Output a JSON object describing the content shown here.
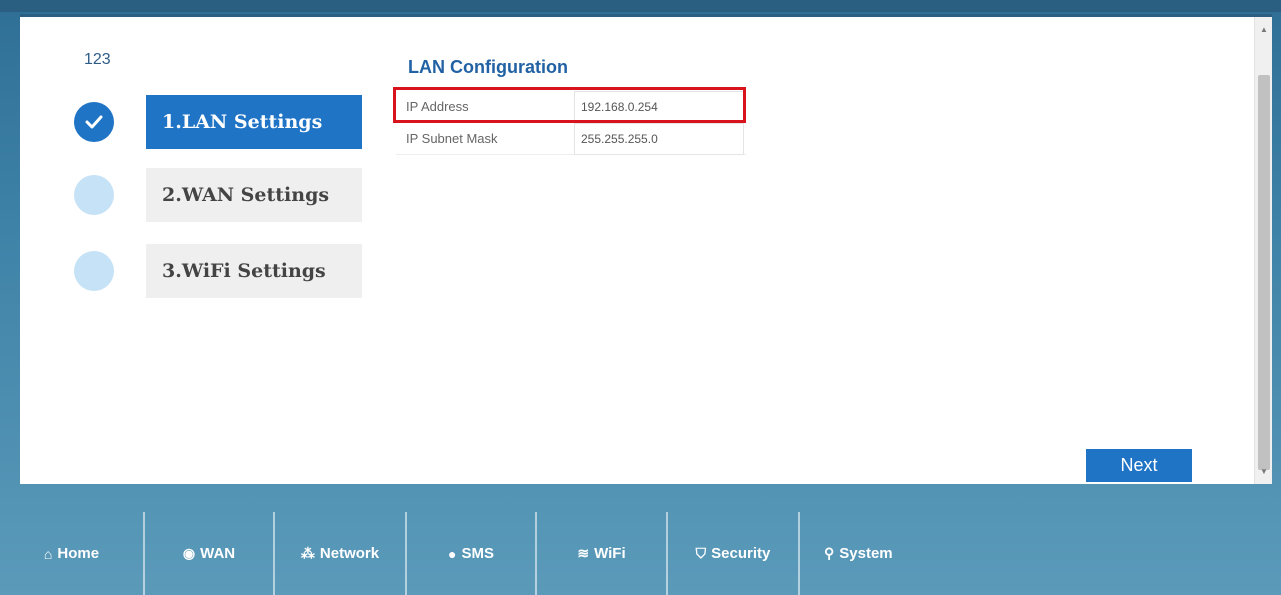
{
  "wizard": {
    "number": "123",
    "steps": [
      {
        "label": "1.LAN Settings"
      },
      {
        "label": "2.WAN Settings"
      },
      {
        "label": "3.WiFi Settings"
      }
    ]
  },
  "lan_config": {
    "title": "LAN Configuration",
    "rows": [
      {
        "label": "IP Address",
        "value": "192.168.0.254"
      },
      {
        "label": "IP Subnet Mask",
        "value": "255.255.255.0"
      }
    ]
  },
  "buttons": {
    "next": "Next"
  },
  "nav": {
    "items": [
      {
        "label": "Home",
        "icon": "home-icon"
      },
      {
        "label": "WAN",
        "icon": "globe-icon"
      },
      {
        "label": "Network",
        "icon": "network-icon"
      },
      {
        "label": "SMS",
        "icon": "sms-icon"
      },
      {
        "label": "WiFi",
        "icon": "wifi-icon"
      },
      {
        "label": "Security",
        "icon": "shield-icon"
      },
      {
        "label": "System",
        "icon": "search-icon"
      }
    ]
  }
}
